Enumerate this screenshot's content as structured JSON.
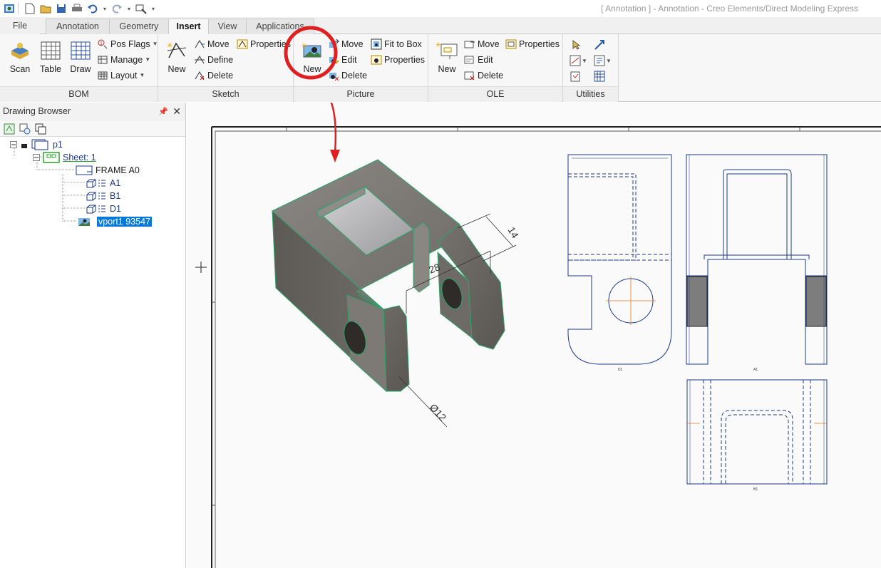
{
  "window": {
    "title": "[ Annotation ] - Annotation - Creo Elements/Direct Modeling Express"
  },
  "tabs": [
    {
      "label": "File"
    },
    {
      "label": "Annotation"
    },
    {
      "label": "Geometry"
    },
    {
      "label": "Insert"
    },
    {
      "label": "View"
    },
    {
      "label": "Applications"
    }
  ],
  "ribbon": {
    "bom": {
      "label": "BOM",
      "scan": "Scan",
      "table": "Table",
      "draw": "Draw",
      "pos_flags": "Pos Flags",
      "manage": "Manage",
      "layout": "Layout"
    },
    "sketch": {
      "label": "Sketch",
      "new": "New",
      "move": "Move",
      "define": "Define",
      "delete": "Delete",
      "properties": "Properties"
    },
    "picture": {
      "label": "Picture",
      "new": "New",
      "move": "Move",
      "edit": "Edit",
      "delete": "Delete",
      "fit_to_box": "Fit to Box",
      "properties": "Properties"
    },
    "ole": {
      "label": "OLE",
      "new": "New",
      "move": "Move",
      "edit": "Edit",
      "delete": "Delete",
      "properties": "Properties"
    },
    "utilities": {
      "label": "Utilities"
    }
  },
  "browser": {
    "title": "Drawing Browser",
    "tree": {
      "root": "p1",
      "sheet": "Sheet: 1",
      "frame": "FRAME A0",
      "views": [
        "A1",
        "B1",
        "D1"
      ],
      "vport": "vport1 93547"
    }
  },
  "drawing": {
    "dimensions": [
      "14",
      "28",
      "Ø12"
    ],
    "view_labels": [
      "D1",
      "A1",
      "B1"
    ]
  },
  "colors": {
    "highlight_circle": "#e02020",
    "selection": "#0a78d7",
    "part_edge": "#2aa56a",
    "hidden_line": "#1a3a8a"
  }
}
